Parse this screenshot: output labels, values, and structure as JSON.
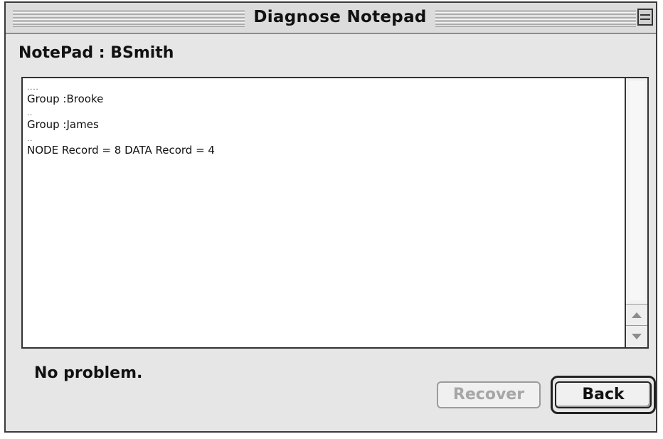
{
  "window": {
    "title": "Diagnose Notepad"
  },
  "notepad": {
    "heading": "NotePad : BSmith",
    "lines": [
      "....",
      "Group :Brooke",
      "..",
      "Group :James",
      "..",
      "NODE Record = 8 DATA Record = 4"
    ]
  },
  "status": {
    "message": "No problem."
  },
  "buttons": {
    "recover_label": "Recover",
    "recover_enabled": false,
    "back_label": "Back",
    "back_default": true
  },
  "icons": {
    "collapse": "collapse-box-icon",
    "scroll_up": "scroll-up-arrow-icon",
    "scroll_down": "scroll-down-arrow-icon"
  }
}
